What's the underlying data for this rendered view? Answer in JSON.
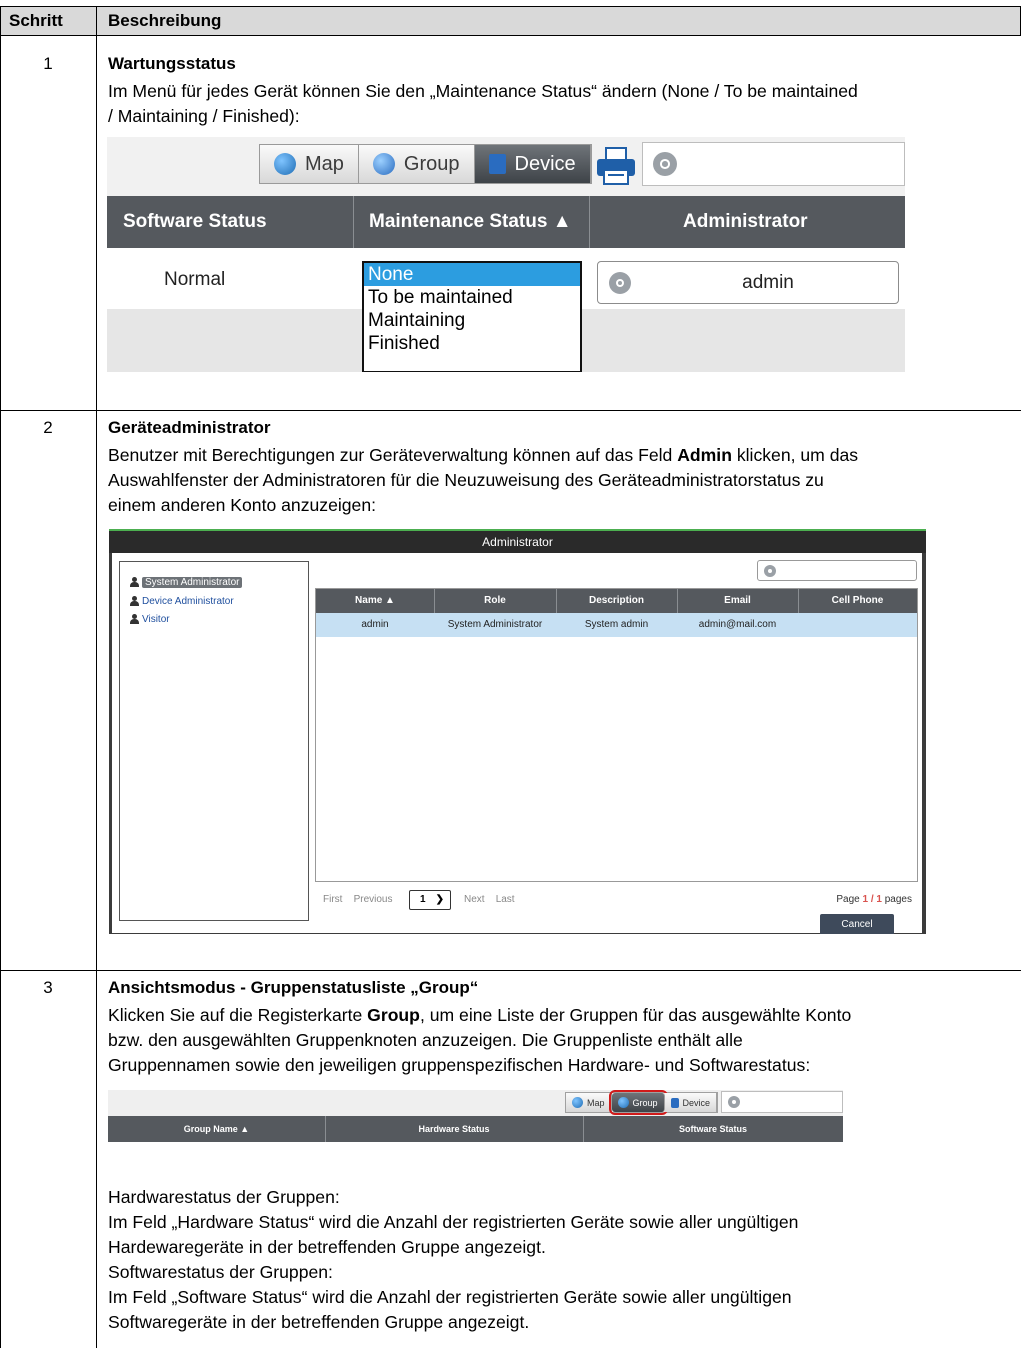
{
  "table": {
    "col_step": "Schritt",
    "col_desc": "Beschreibung"
  },
  "steps": [
    {
      "number": "1",
      "title": "Wartungsstatus",
      "text_1": "Im Menü für jedes Gerät können Sie den „Maintenance Status“ ändern (None / To be maintained",
      "text_2": "/ Maintaining / Finished):"
    },
    {
      "number": "2",
      "title": "Geräteadministrator",
      "line_1_pre": "Benutzer mit Berechtigungen zur Geräteverwaltung können auf das Feld ",
      "line_1_bold": "Admin",
      "line_1_post": " klicken, um das",
      "line_2": "Auswahlfenster der Administratoren für die Neuzuweisung des Geräteadministratorstatus zu",
      "line_3": "einem anderen Konto anzuzeigen:"
    },
    {
      "number": "3",
      "title": "Ansichtsmodus - Gruppenstatusliste „Group“",
      "line_1_pre": "Klicken Sie auf die Registerkarte ",
      "line_1_bold": "Group",
      "line_1_post": ", um eine Liste der Gruppen für das ausgewählte Konto",
      "line_2": "bzw. den ausgewählten Gruppenknoten anzuzeigen. Die Gruppenliste enthält alle",
      "line_3": "Gruppennamen sowie den jeweiligen gruppenspezifischen Hardware- und Softwarestatus:",
      "hw_heading": "Hardwarestatus der Gruppen:",
      "hw_text_1": "Im Feld „Hardware Status“ wird die Anzahl der registrierten Geräte sowie aller ungültigen",
      "hw_text_2": "Hardewaregeräte in der betreffenden Gruppe angezeigt.",
      "sw_heading": "Softwarestatus der Gruppen:",
      "sw_text_1": "Im Feld „Software Status“ wird die Anzahl der registrierten Geräte sowie aller ungültigen",
      "sw_text_2": "Softwaregeräte in der betreffenden Gruppe angezeigt."
    }
  ],
  "shot1": {
    "tabs": [
      "Map",
      "Group",
      "Device"
    ],
    "active_tab": "Device",
    "columns": [
      "Software Status",
      "Maintenance Status ▲",
      "Administrator"
    ],
    "software_status": "Normal",
    "options": [
      "None",
      "To be maintained",
      "Maintaining",
      "Finished"
    ],
    "selected_option": "None",
    "admin_value": "admin"
  },
  "shot2": {
    "window_title": "Administrator",
    "tree": [
      "System Administrator",
      "Device Administrator",
      "Visitor"
    ],
    "columns": [
      "Name ▲",
      "Role",
      "Description",
      "Email",
      "Cell Phone"
    ],
    "row": [
      "admin",
      "System Administrator",
      "System admin",
      "admin@mail.com",
      ""
    ],
    "pager_first": "First",
    "pager_previous": "Previous",
    "page_value": "1",
    "pager_next": "Next",
    "pager_last": "Last",
    "page_label": "Page",
    "page_current": "1 / 1",
    "page_suffix": "pages",
    "cancel": "Cancel"
  },
  "shot3": {
    "tabs": [
      "Map",
      "Group",
      "Device"
    ],
    "active_tab": "Group",
    "columns": [
      "Group Name ▲",
      "Hardware Status",
      "Software Status"
    ]
  },
  "colors": {
    "header_gray": "#d9d9d9",
    "grid_header": "#55595e",
    "selection_blue": "#2c9de0",
    "row_highlight": "#c6e0f3",
    "highlight_red": "#d11a1a"
  }
}
